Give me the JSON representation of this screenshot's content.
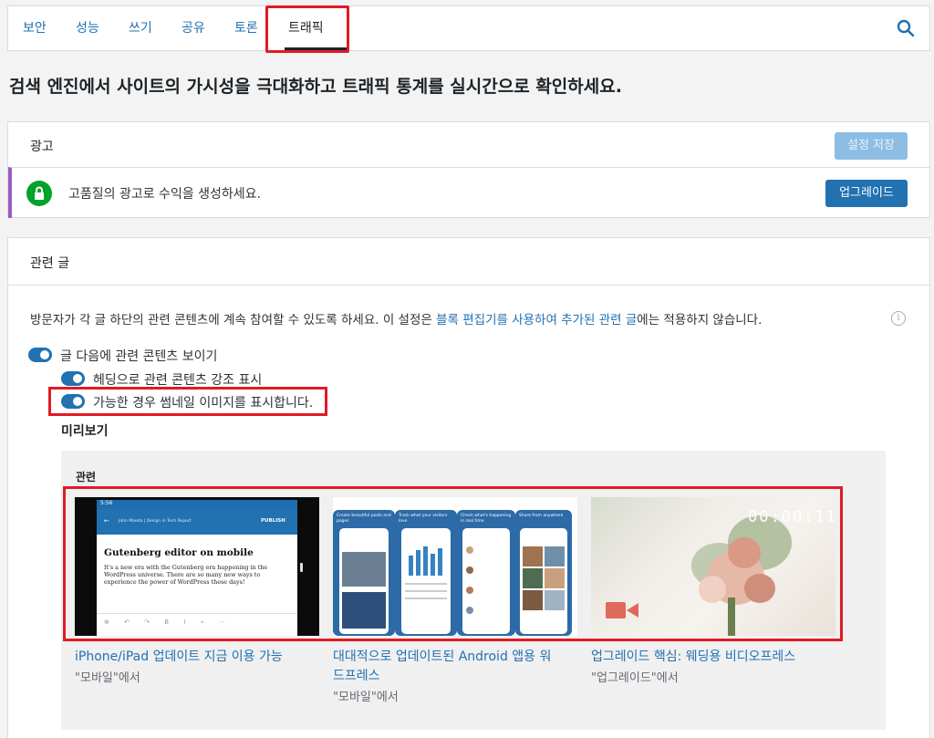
{
  "tabs": [
    {
      "label": "보안"
    },
    {
      "label": "성능"
    },
    {
      "label": "쓰기"
    },
    {
      "label": "공유"
    },
    {
      "label": "토론"
    },
    {
      "label": "트래픽"
    }
  ],
  "active_tab": "트래픽",
  "headline": "검색 엔진에서 사이트의 가시성을 극대화하고 트래픽 통계를 실시간으로 확인하세요.",
  "ads": {
    "title": "광고",
    "save_label": "설정 저장",
    "nudge_text": "고품질의 광고로 수익을 생성하세요.",
    "upgrade_label": "업그레이드"
  },
  "related": {
    "title": "관련 글",
    "description_pre": "방문자가 각 글 하단의 관련 콘텐츠에 계속 참여할 수 있도록 하세요. 이 설정은 ",
    "description_link": "블록 편집기를 사용하여 추가된 관련 글",
    "description_post": "에는 적용하지 않습니다.",
    "toggles": [
      {
        "label": "글 다음에 관련 콘텐츠 보이기",
        "on": true
      },
      {
        "label": "헤딩으로 관련 콘텐츠 강조 표시",
        "on": true
      },
      {
        "label": "가능한 경우 썸네일 이미지를 표시합니다.",
        "on": true
      }
    ],
    "preview_label": "미리보기",
    "preview_heading": "관련",
    "posts": [
      {
        "title_line1": "iPhone/iPad 업데이트 지금 이용 가능",
        "title_line2": "",
        "category": "\"모바일\"에서"
      },
      {
        "title_line1": "대대적으로 업데이트된 Android 앱용 워",
        "title_line2": "드프레스",
        "category": "\"모바일\"에서"
      },
      {
        "title_line1": "업그레이드 핵심: 웨딩용 비디오프레스",
        "title_line2": "",
        "category": "\"업그레이드\"에서"
      }
    ],
    "thumb1": {
      "status_time": "5:56",
      "topbar": "John Maeda | Design in Tech Report",
      "publish": "PUBLISH",
      "heading": "Gutenberg editor on mobile",
      "body": "It's a new era with the Gutenberg era happening in the WordPress universe. There are so many new ways to experience the power of WordPress these days!"
    },
    "thumb2": {
      "phones": [
        "Create beautiful posts and pages",
        "Track what your visitors love",
        "Check what's happening in real time",
        "Share from anywhere"
      ]
    },
    "thumb3": {
      "timer": "00:00:11"
    }
  },
  "colors": {
    "accent": "#2271b1",
    "highlight": "#e01b24",
    "success": "#00a32a",
    "nudge_border": "#9a5ec2"
  }
}
